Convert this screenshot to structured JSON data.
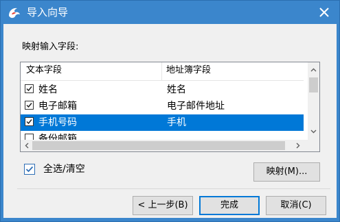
{
  "window": {
    "title": "导入向导",
    "colors": {
      "titlebar": "#3b86cc",
      "selection": "#0078d7",
      "background": "#f0f0f0"
    },
    "icons": {
      "app": "foxmail-logo-icon",
      "close": "close-icon"
    }
  },
  "mapping": {
    "caption": "映射输入字段:",
    "columns": [
      "文本字段",
      "地址簿字段"
    ],
    "rows": [
      {
        "checked": true,
        "source": "姓名",
        "target": "姓名",
        "selected": false
      },
      {
        "checked": true,
        "source": "电子邮箱",
        "target": "电子邮件地址",
        "selected": false
      },
      {
        "checked": true,
        "source": "手机号码",
        "target": "手机",
        "selected": true
      },
      {
        "checked": false,
        "source": "备份邮箱",
        "target": "",
        "selected": false
      }
    ]
  },
  "select_all": {
    "checked": true,
    "label": "全选/清空"
  },
  "buttons": {
    "map": "映射(M)...",
    "prev": "< 上一步(B)",
    "finish": "完成",
    "cancel": "取消(C)"
  }
}
